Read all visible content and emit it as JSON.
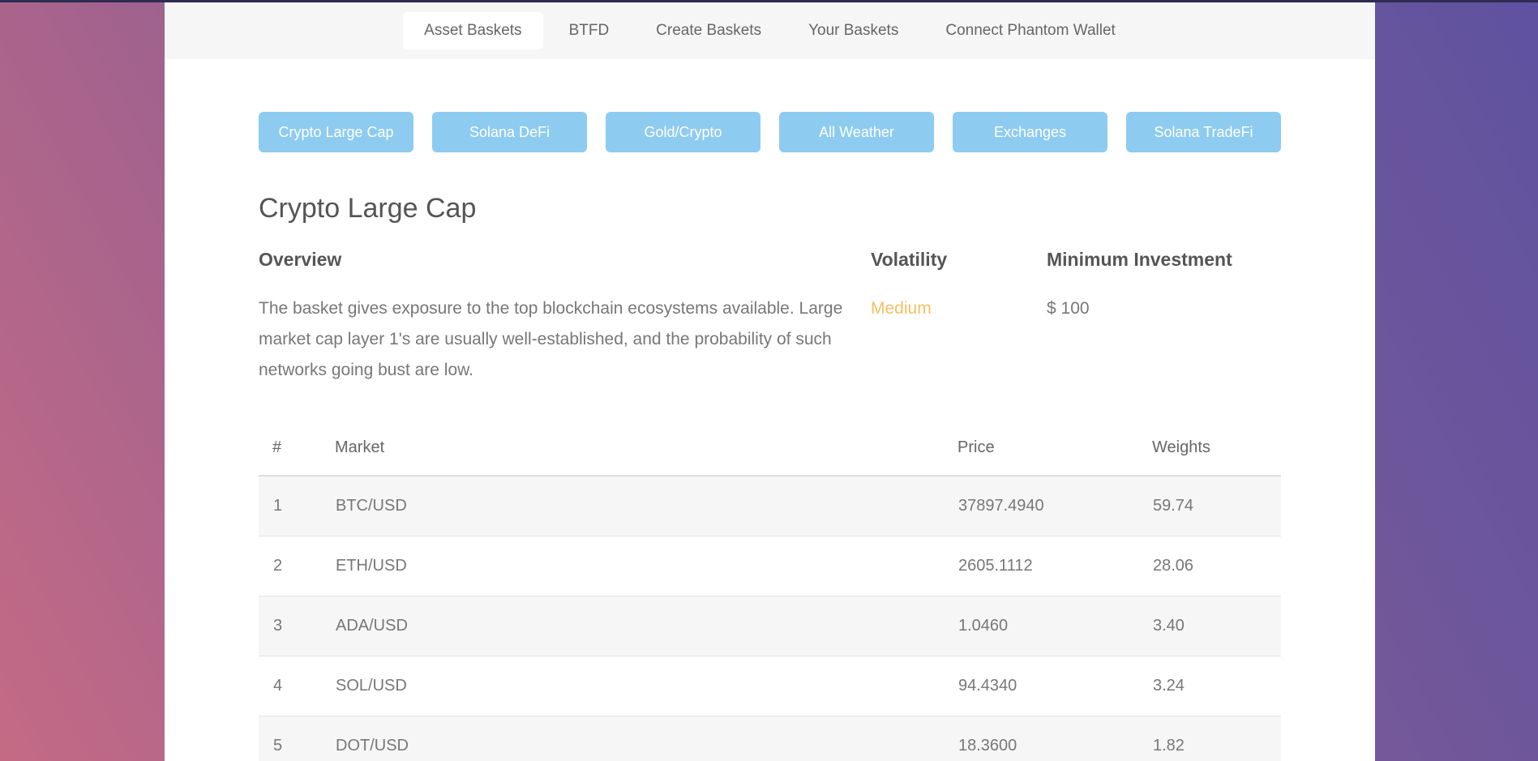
{
  "nav": {
    "items": [
      {
        "label": "Asset Baskets",
        "active": true
      },
      {
        "label": "BTFD",
        "active": false
      },
      {
        "label": "Create Baskets",
        "active": false
      },
      {
        "label": "Your Baskets",
        "active": false
      },
      {
        "label": "Connect Phantom Wallet",
        "active": false
      }
    ]
  },
  "baskets": [
    "Crypto Large Cap",
    "Solana DeFi",
    "Gold/Crypto",
    "All Weather",
    "Exchanges",
    "Solana TradeFi"
  ],
  "detail": {
    "title": "Crypto Large Cap",
    "overview_heading": "Overview",
    "overview_text": "The basket gives exposure to the top blockchain ecosystems available. Large market cap layer 1's are usually well-established, and the probability of such networks going bust are low.",
    "volatility_heading": "Volatility",
    "volatility_value": "Medium",
    "min_investment_heading": "Minimum Investment",
    "min_investment_value": "$ 100"
  },
  "table": {
    "headers": [
      "#",
      "Market",
      "Price",
      "Weights"
    ],
    "rows": [
      [
        "1",
        "BTC/USD",
        "37897.4940",
        "59.74"
      ],
      [
        "2",
        "ETH/USD",
        "2605.1112",
        "28.06"
      ],
      [
        "3",
        "ADA/USD",
        "1.0460",
        "3.40"
      ],
      [
        "4",
        "SOL/USD",
        "94.4340",
        "3.24"
      ],
      [
        "5",
        "DOT/USD",
        "18.3600",
        "1.82"
      ]
    ]
  },
  "colors": {
    "button": "#8ecbf0",
    "volatility": "#f4c062",
    "nav_bg": "#f6f6f6"
  }
}
